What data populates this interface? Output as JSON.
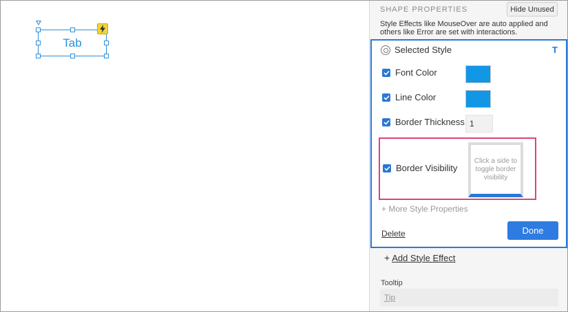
{
  "canvas": {
    "widget_label": "Tab"
  },
  "panel": {
    "title": "SHAPE PROPERTIES",
    "hide_unused_label": "Hide Unused",
    "note": "Style Effects like MouseOver are auto applied and others like Error are set with interactions.",
    "selected_style": {
      "title": "Selected Style",
      "t_icon_label": "T",
      "properties": [
        {
          "label": "Font Color",
          "checked": true,
          "color": "#1296e6"
        },
        {
          "label": "Line Color",
          "checked": true,
          "color": "#1296e6"
        },
        {
          "label": "Border Thickness",
          "checked": true,
          "value": "1"
        },
        {
          "label": "Border Visibility",
          "checked": true,
          "hint": "Click a side to toggle border visibility"
        }
      ],
      "more_properties": "+ More Style Properties",
      "delete_label": "Delete",
      "done_label": "Done"
    },
    "add_style_effect_label": "Add Style Effect",
    "tooltip": {
      "label": "Tooltip",
      "placeholder": "Tip"
    }
  },
  "colors": {
    "accent": "#2b78d4",
    "highlight": "#d9437a",
    "swatch": "#1296e6",
    "lightning": "#f2d33a"
  }
}
